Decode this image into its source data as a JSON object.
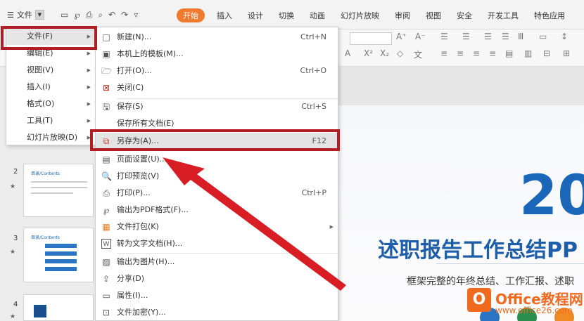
{
  "menubar": {
    "file_label": "文件",
    "tabs": [
      "开始",
      "插入",
      "设计",
      "切换",
      "动画",
      "幻灯片放映",
      "审阅",
      "视图",
      "安全",
      "开发工具",
      "特色应用"
    ]
  },
  "ribbon": {
    "font_grow": "A⁺",
    "font_shrink": "A⁻",
    "font_color_a": "A",
    "superscript": "X²",
    "subscript": "X₂"
  },
  "thumbs": [
    {
      "num": "2",
      "title": "目录/Contents"
    },
    {
      "num": "3",
      "title": "目录/Contents"
    },
    {
      "num": "4",
      "title": ""
    }
  ],
  "slide": {
    "big_text": "20",
    "title": "述职报告工作总结PP",
    "subtitle": "框架完整的年终总结、工作汇报、述职"
  },
  "menu1": [
    {
      "label": "文件(F)",
      "active": true
    },
    {
      "label": "编辑(E)",
      "active": false
    },
    {
      "label": "视图(V)",
      "active": false
    },
    {
      "label": "插入(I)",
      "active": false
    },
    {
      "label": "格式(O)",
      "active": false
    },
    {
      "label": "工具(T)",
      "active": false
    },
    {
      "label": "幻灯片放映(D)",
      "active": false
    }
  ],
  "menu2": [
    {
      "label": "新建(N)...",
      "shortcut": "Ctrl+N",
      "icon": "new-doc-icon",
      "glyph": "□"
    },
    {
      "label": "本机上的模板(M)...",
      "shortcut": "",
      "icon": "template-icon",
      "glyph": "▣"
    },
    {
      "label": "打开(O)...",
      "shortcut": "Ctrl+O",
      "icon": "folder-icon",
      "glyph": "🗁"
    },
    {
      "label": "关闭(C)",
      "shortcut": "",
      "icon": "close-doc-icon",
      "glyph": "⊠"
    },
    {
      "label": "保存(S)",
      "shortcut": "Ctrl+S",
      "icon": "save-icon",
      "glyph": "🖫"
    },
    {
      "label": "保存所有文档(E)",
      "shortcut": "",
      "icon": "",
      "glyph": ""
    },
    {
      "label": "另存为(A)...",
      "shortcut": "F12",
      "icon": "save-as-icon",
      "glyph": "⧉"
    },
    {
      "label": "页面设置(U)...",
      "shortcut": "",
      "icon": "page-setup-icon",
      "glyph": "▤"
    },
    {
      "label": "打印预览(V)",
      "shortcut": "",
      "icon": "print-preview-icon",
      "glyph": "🔍"
    },
    {
      "label": "打印(P)...",
      "shortcut": "Ctrl+P",
      "icon": "print-icon",
      "glyph": "⎙"
    },
    {
      "label": "输出为PDF格式(F)...",
      "shortcut": "",
      "icon": "pdf-icon",
      "glyph": "℘"
    },
    {
      "label": "文件打包(K)",
      "shortcut": "",
      "icon": "package-icon",
      "glyph": "▦"
    },
    {
      "label": "转为文字文档(H)...",
      "shortcut": "",
      "icon": "to-text-icon",
      "glyph": "W"
    },
    {
      "label": "输出为图片(H)...",
      "shortcut": "",
      "icon": "image-export-icon",
      "glyph": "▨"
    },
    {
      "label": "分享(D)",
      "shortcut": "",
      "icon": "share-icon",
      "glyph": "⇪"
    },
    {
      "label": "属性(I)...",
      "shortcut": "",
      "icon": "properties-icon",
      "glyph": "▭"
    },
    {
      "label": "文件加密(Y)...",
      "shortcut": "",
      "icon": "encrypt-icon",
      "glyph": "⊡"
    }
  ],
  "watermark": {
    "brand": "Office教程网",
    "url": "www.office26.com"
  },
  "colors": {
    "accent_orange": "#ef7b2f",
    "highlight_red": "#b01d23",
    "slide_blue": "#1a66b8"
  }
}
